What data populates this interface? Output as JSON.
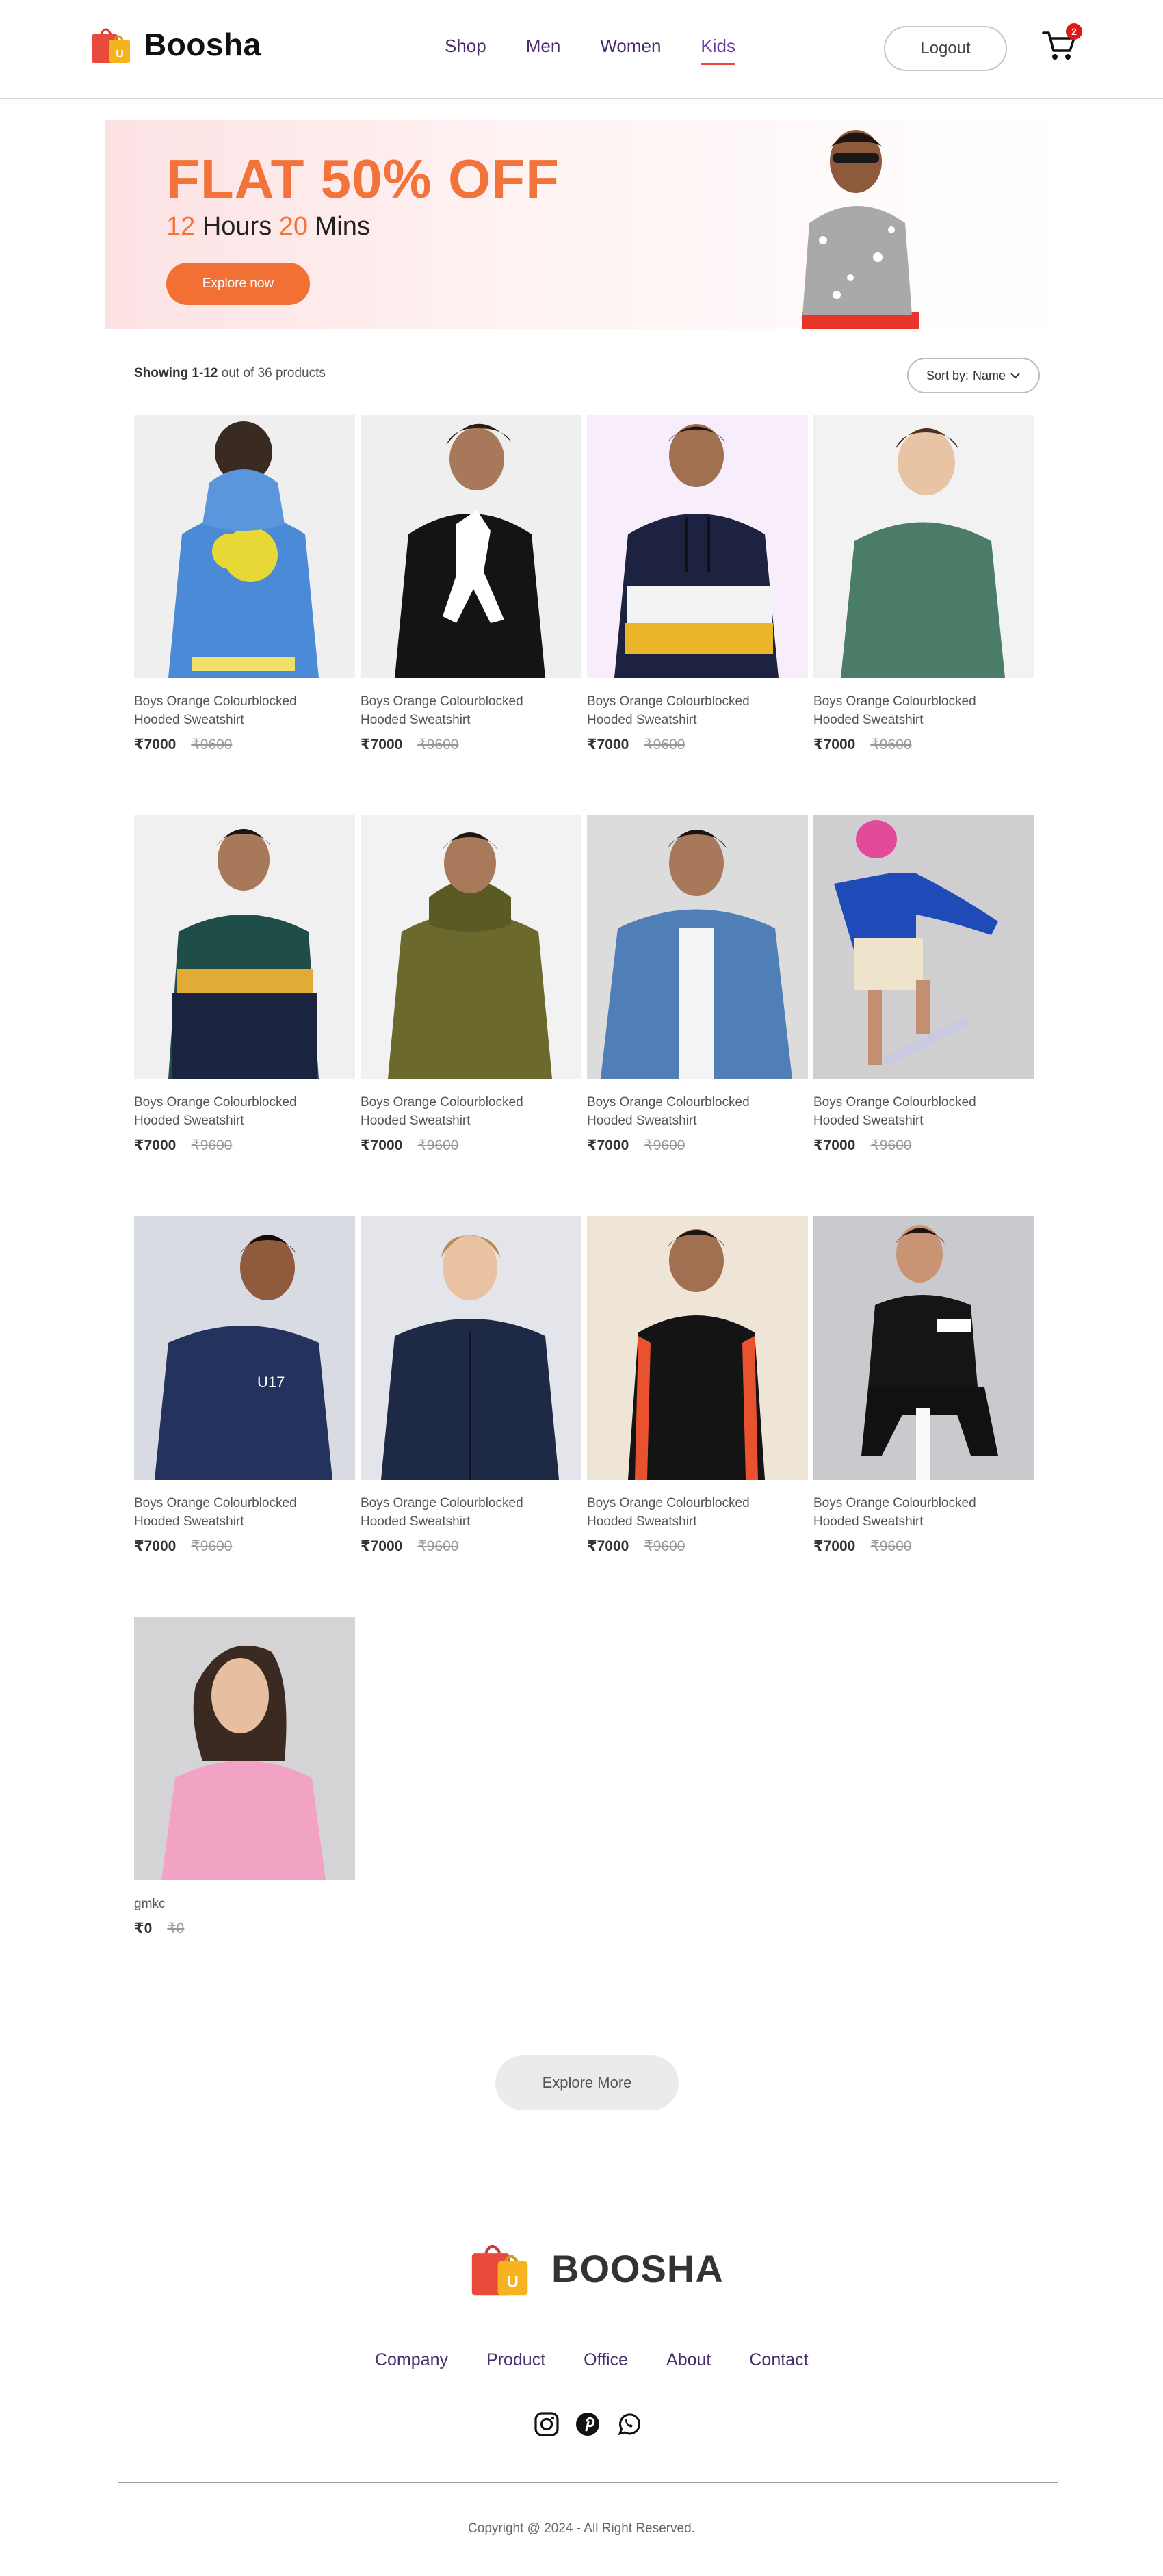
{
  "header": {
    "brand": "Boosha",
    "nav": [
      {
        "label": "Shop",
        "active": false
      },
      {
        "label": "Men",
        "active": false
      },
      {
        "label": "Women",
        "active": false
      },
      {
        "label": "Kids",
        "active": true
      }
    ],
    "logout_label": "Logout",
    "cart_count": "2"
  },
  "banner": {
    "title": "FLAT 50% OFF",
    "hours_value": "12",
    "hours_label": "Hours",
    "mins_value": "20",
    "mins_label": "Mins",
    "cta": "Explore now"
  },
  "toolbar": {
    "showing_range": "Showing 1-12",
    "showing_total": "out of 36 products",
    "sort_label": "Sort by:",
    "sort_value": "Name"
  },
  "products": [
    {
      "name": "Boys Orange Colourblocked Hooded Sweatshirt",
      "price": "₹7000",
      "old_price": "₹9600"
    },
    {
      "name": "Boys Orange Colourblocked Hooded Sweatshirt",
      "price": "₹7000",
      "old_price": "₹9600"
    },
    {
      "name": "Boys Orange Colourblocked Hooded Sweatshirt",
      "price": "₹7000",
      "old_price": "₹9600"
    },
    {
      "name": "Boys Orange Colourblocked Hooded Sweatshirt",
      "price": "₹7000",
      "old_price": "₹9600"
    },
    {
      "name": "Boys Orange Colourblocked Hooded Sweatshirt",
      "price": "₹7000",
      "old_price": "₹9600"
    },
    {
      "name": "Boys Orange Colourblocked Hooded Sweatshirt",
      "price": "₹7000",
      "old_price": "₹9600"
    },
    {
      "name": "Boys Orange Colourblocked Hooded Sweatshirt",
      "price": "₹7000",
      "old_price": "₹9600"
    },
    {
      "name": "Boys Orange Colourblocked Hooded Sweatshirt",
      "price": "₹7000",
      "old_price": "₹9600"
    },
    {
      "name": "Boys Orange Colourblocked Hooded Sweatshirt",
      "price": "₹7000",
      "old_price": "₹9600"
    },
    {
      "name": "Boys Orange Colourblocked Hooded Sweatshirt",
      "price": "₹7000",
      "old_price": "₹9600"
    },
    {
      "name": "Boys Orange Colourblocked Hooded Sweatshirt",
      "price": "₹7000",
      "old_price": "₹9600"
    },
    {
      "name": "Boys Orange Colourblocked Hooded Sweatshirt",
      "price": "₹7000",
      "old_price": "₹9600"
    },
    {
      "name": "gmkc",
      "price": "₹0",
      "old_price": "₹0"
    }
  ],
  "explore_more": "Explore More",
  "footer": {
    "brand": "BOOSHA",
    "links": [
      "Company",
      "Product",
      "Office",
      "About",
      "Contact"
    ],
    "social": [
      "instagram-icon",
      "pinterest-icon",
      "whatsapp-icon"
    ],
    "copyright": "Copyright @ 2024 - All Right Reserved."
  },
  "colors": {
    "accent": "#f2743b",
    "nav_text": "#4a2d6b",
    "badge": "#e01818"
  }
}
